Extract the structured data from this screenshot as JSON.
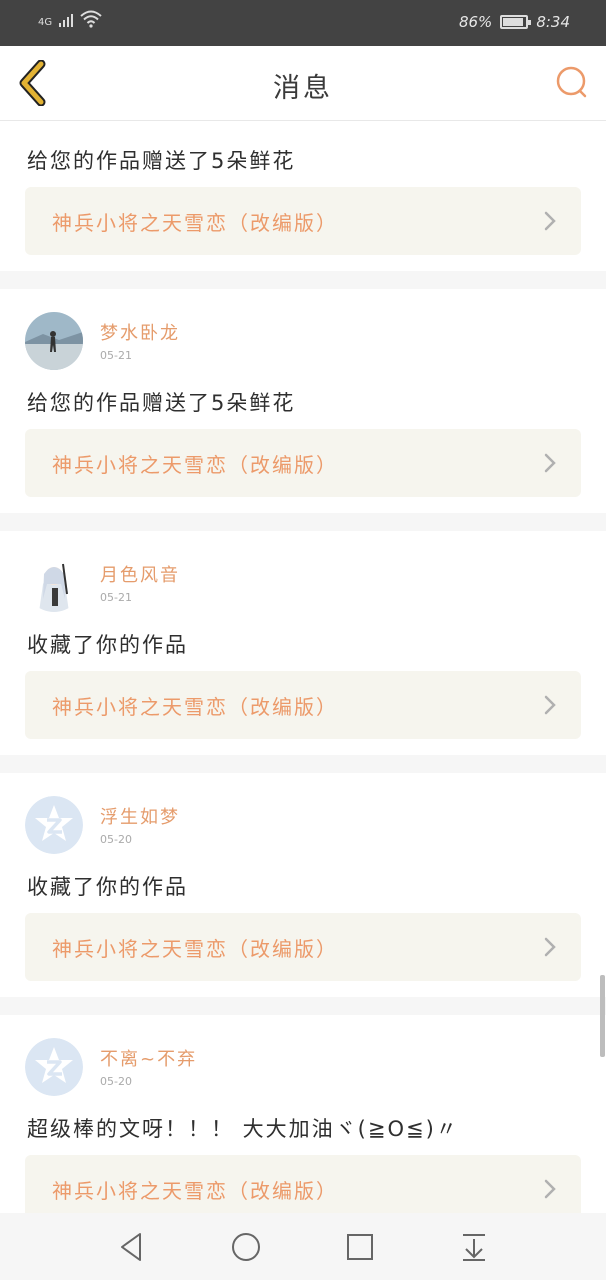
{
  "status": {
    "network": "4G",
    "battery": "86%",
    "time": "8:34"
  },
  "header": {
    "title": "消息",
    "back_icon": "back-chevron-icon",
    "search_icon": "search-icon"
  },
  "feed": [
    {
      "user": "",
      "date": "",
      "message": "给您的作品赠送了5朵鲜花",
      "work": "神兵小将之天雪恋（改编版）"
    },
    {
      "user": "梦水卧龙",
      "date": "05-21",
      "message": "给您的作品赠送了5朵鲜花",
      "work": "神兵小将之天雪恋（改编版）"
    },
    {
      "user": "月色风音",
      "date": "05-21",
      "message": "收藏了你的作品",
      "work": "神兵小将之天雪恋（改编版）"
    },
    {
      "user": "浮生如梦",
      "date": "05-20",
      "message": "收藏了你的作品",
      "work": "神兵小将之天雪恋（改编版）"
    },
    {
      "user": "不离~不弃",
      "date": "05-20",
      "message": "超级棒的文呀！！！ 大大加油ヾ(≧O≦)〃",
      "work": "神兵小将之天雪恋（改编版）"
    }
  ],
  "colors": {
    "accent": "#ec9a6a",
    "username": "#e59c6c",
    "back_icon": "#e2b233",
    "work_bg": "#f6f5ee"
  },
  "nav": {
    "back": "nav-back-icon",
    "home": "nav-home-icon",
    "recent": "nav-recent-icon",
    "extra": "nav-pulldown-icon"
  }
}
